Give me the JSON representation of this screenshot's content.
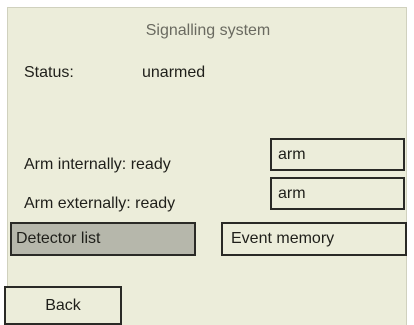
{
  "screen": {
    "title": "Signalling system"
  },
  "status": {
    "label": "Status:",
    "value": "unarmed"
  },
  "arm_internally": {
    "label": "Arm internally: ready",
    "button_label": "arm"
  },
  "arm_externally": {
    "label": "Arm externally: ready",
    "button_label": "arm"
  },
  "buttons": {
    "detector_list": "Detector list",
    "event_memory": "Event memory",
    "back": "Back"
  },
  "colors": {
    "panel_background": "#ecedda",
    "selected_button": "#b6b7ab",
    "border": "#2a2a26",
    "title_text": "#6a6a60"
  }
}
